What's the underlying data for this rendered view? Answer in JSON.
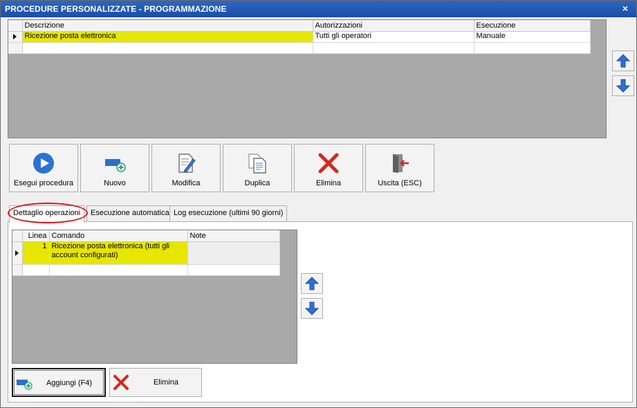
{
  "window": {
    "title": "PROCEDURE PERSONALIZZATE -  PROGRAMMAZIONE",
    "close_glyph": "×"
  },
  "procedures_grid": {
    "columns": [
      "Descrizione",
      "Autorizzazioni",
      "Esecuzione"
    ],
    "rows": [
      {
        "descrizione": "Ricezione posta elettronica",
        "autorizzazioni": "Tutti gli operatori",
        "esecuzione": "Manuale",
        "selected": true
      }
    ]
  },
  "toolbar": {
    "buttons": [
      {
        "label": "Esegui procedura",
        "icon": "play-icon"
      },
      {
        "label": "Nuovo",
        "icon": "new-icon"
      },
      {
        "label": "Modifica",
        "icon": "edit-icon"
      },
      {
        "label": "Duplica",
        "icon": "duplicate-icon"
      },
      {
        "label": "Elimina",
        "icon": "delete-icon"
      },
      {
        "label": "Uscita (ESC)",
        "icon": "exit-icon"
      }
    ]
  },
  "tabs": [
    {
      "label": "Dettaglio operazioni",
      "active": true
    },
    {
      "label": "Esecuzione automatica",
      "active": false
    },
    {
      "label": "Log esecuzione (ultimi 90 giorni)",
      "active": false
    }
  ],
  "operations_grid": {
    "columns": [
      "Linea",
      "Comando",
      "Note"
    ],
    "rows": [
      {
        "linea": "1",
        "comando": "Ricezione posta elettronica (tutti gli account configurati)",
        "note": "",
        "selected": true
      }
    ]
  },
  "bottom_buttons": {
    "add_label": "Aggiungi (F4)",
    "delete_label": "Elimina"
  },
  "colors": {
    "title_bar": "#1f57b3",
    "selection": "#e6e600",
    "arrow_blue": "#2f6fd0",
    "delete_red": "#d9261c",
    "highlight_ellipse": "#e01515"
  }
}
